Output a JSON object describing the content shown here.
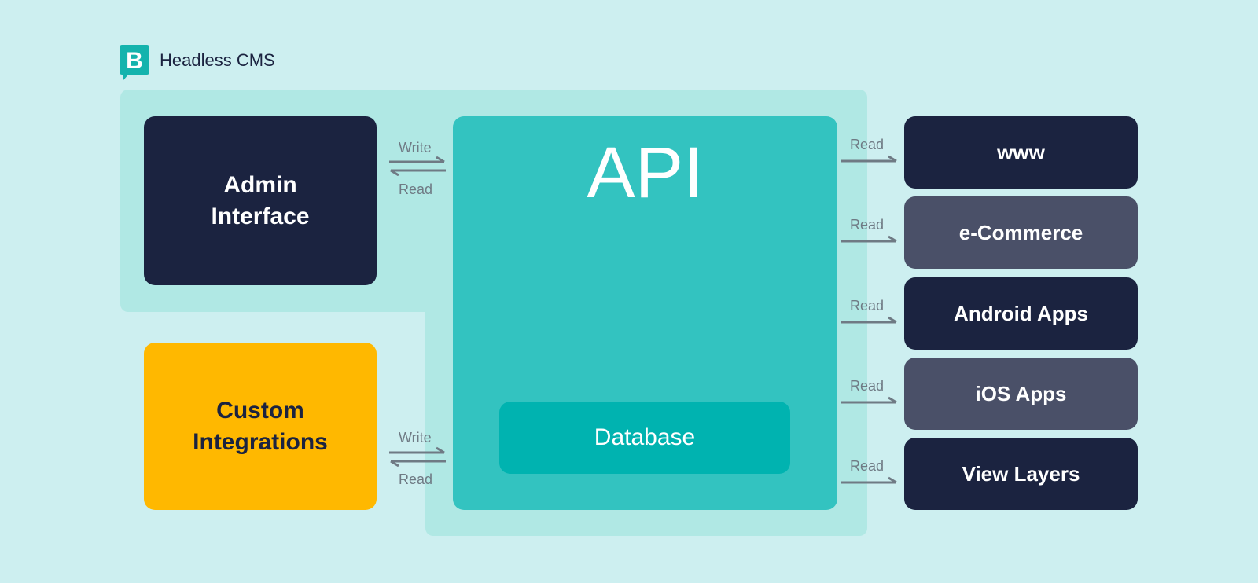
{
  "header": {
    "logo_icon": "b-speech-bubble-icon",
    "title": "Headless CMS"
  },
  "left": {
    "admin": "Admin Interface",
    "custom": "Custom Integrations"
  },
  "center": {
    "api": "API",
    "database": "Database"
  },
  "connectors": {
    "admin": {
      "top": "Write",
      "bottom": "Read"
    },
    "custom": {
      "top": "Write",
      "bottom": "Read"
    }
  },
  "outputs": [
    {
      "label": "www",
      "arrow_label": "Read",
      "style": "dark"
    },
    {
      "label": "e-Commerce",
      "arrow_label": "Read",
      "style": "slate"
    },
    {
      "label": "Android Apps",
      "arrow_label": "Read",
      "style": "dark"
    },
    {
      "label": "iOS Apps",
      "arrow_label": "Read",
      "style": "slate"
    },
    {
      "label": "View Layers",
      "arrow_label": "Read",
      "style": "dark"
    }
  ],
  "colors": {
    "background": "#cdeff0",
    "highlight": "#b0e8e4",
    "api": "#33c3c0",
    "database": "#00b3b0",
    "dark": "#1b2340",
    "slate": "#4a5068",
    "custom": "#ffb800",
    "logo": "#14b3ad"
  }
}
